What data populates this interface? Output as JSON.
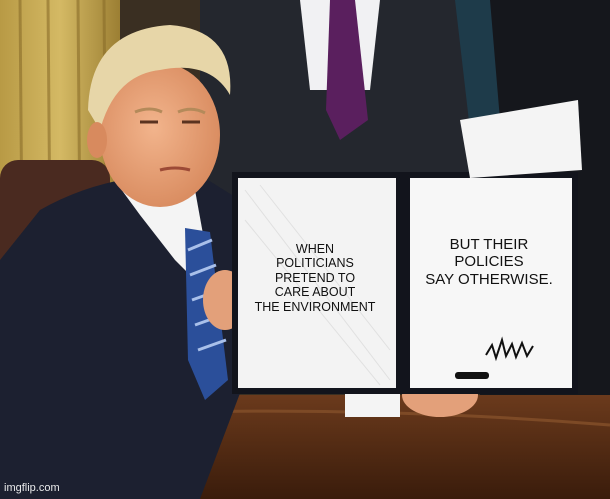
{
  "meme": {
    "left_text": "WHEN\nPOLITICIANS\nPRETEND TO\nCARE ABOUT\nTHE ENVIRONMENT",
    "right_text": "BUT THEIR\nPOLICIES\nSAY OTHERWISE.",
    "watermark": "imgflip.com"
  }
}
